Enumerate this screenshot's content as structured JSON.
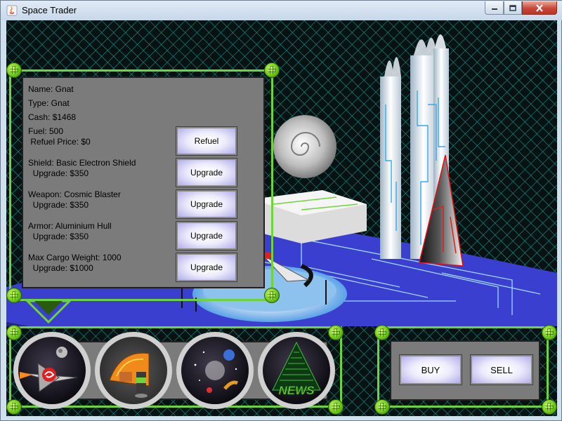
{
  "window": {
    "title": "Space Trader"
  },
  "ship": {
    "name_text": "Name: Gnat",
    "type_text": "Type: Gnat",
    "cash_text": "Cash: $1468",
    "fuel_text": "Fuel: 500",
    "refuel_price_text": " Refuel Price: $0",
    "shield_text": "Shield: Basic Electron Shield",
    "shield_upgrade_text": "  Upgrade: $350",
    "weapon_text": "Weapon: Cosmic Blaster",
    "weapon_upgrade_text": "  Upgrade: $350",
    "armor_text": "Armor: Aluminium Hull",
    "armor_upgrade_text": "  Upgrade: $350",
    "cargo_text": "Max Cargo Weight: 1000",
    "cargo_upgrade_text": "  Upgrade: $1000"
  },
  "buttons": {
    "refuel": "Refuel",
    "upgrade": "Upgrade"
  },
  "nav": {
    "icons": [
      "ship-icon",
      "hangar-icon",
      "galaxy-map-icon",
      "news-icon"
    ],
    "news_label": "NEWS"
  },
  "trade": {
    "buy": "BUY",
    "sell": "SELL"
  },
  "colors": {
    "frame_green": "#6ed43a",
    "panel_gray": "#7b7b7b",
    "grid_cyan": "#1f8f8a",
    "floor_blue": "#3b3fd0"
  }
}
